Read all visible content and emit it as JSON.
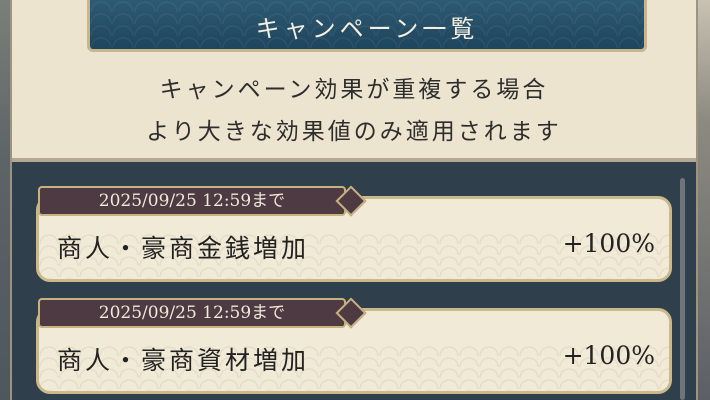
{
  "dialog": {
    "title": "キャンペーン一覧",
    "notice_lines": [
      "キャンペーン効果が重複する場合",
      "より大きな効果値のみ適用されます"
    ]
  },
  "campaigns": [
    {
      "deadline": "2025/09/25 12:59まで",
      "name": "商人・豪商金銭増加",
      "value": "+100%"
    },
    {
      "deadline": "2025/09/25 12:59まで",
      "name": "商人・豪商資材増加",
      "value": "+100%"
    }
  ],
  "colors": {
    "banner": "#1e455d",
    "panel": "#2f3f4c",
    "card": "#f1ead7",
    "deadline_tag": "#4e3a42",
    "accent_gold": "#c8b27f"
  }
}
